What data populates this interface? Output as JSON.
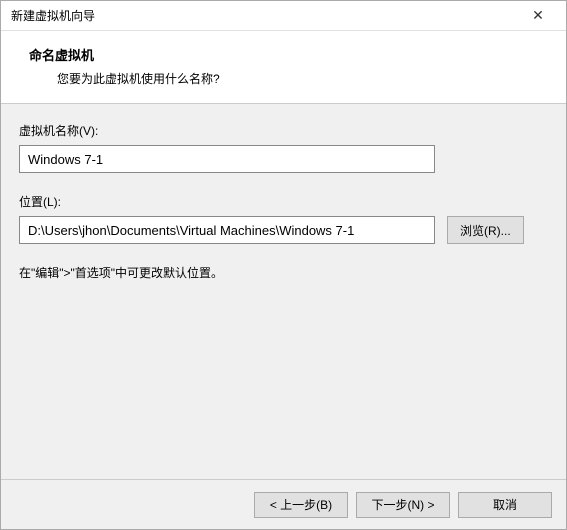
{
  "titlebar": {
    "title": "新建虚拟机向导",
    "close": "✕"
  },
  "header": {
    "title": "命名虚拟机",
    "subtitle": "您要为此虚拟机使用什么名称?"
  },
  "form": {
    "name_label": "虚拟机名称(V):",
    "name_value": "Windows 7-1",
    "location_label": "位置(L):",
    "location_value": "D:\\Users\\jhon\\Documents\\Virtual Machines\\Windows 7-1",
    "browse_label": "浏览(R)...",
    "hint": "在\"编辑\">\"首选项\"中可更改默认位置。"
  },
  "footer": {
    "back": "< 上一步(B)",
    "next": "下一步(N) >",
    "cancel": "取消"
  }
}
